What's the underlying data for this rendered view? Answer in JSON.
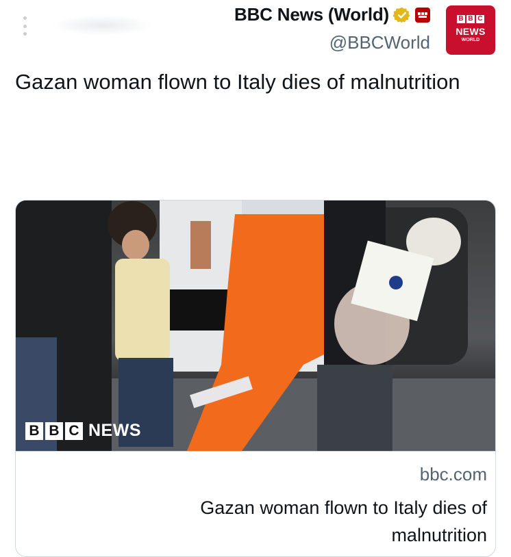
{
  "account": {
    "name": "BBC News (World)",
    "handle": "@BBCWorld"
  },
  "avatar": {
    "blocks": [
      "B",
      "B",
      "C"
    ],
    "word": "NEWS",
    "sub": "WORLD"
  },
  "tweet": {
    "text": "Gazan woman flown to Italy dies of malnutrition"
  },
  "card": {
    "domain": "bbc.com",
    "title": "Gazan woman flown to Italy dies of malnutrition",
    "image_watermark": {
      "blocks": [
        "B",
        "B",
        "C"
      ],
      "word": "NEWS"
    }
  },
  "colors": {
    "bbc_red": "#c8102e",
    "verified_gold": "#e2b719",
    "text_primary": "#0f1419",
    "text_secondary": "#536471",
    "border": "#cfd9de"
  },
  "icons": [
    "more-icon",
    "verified-badge-icon",
    "affiliate-badge-icon"
  ]
}
